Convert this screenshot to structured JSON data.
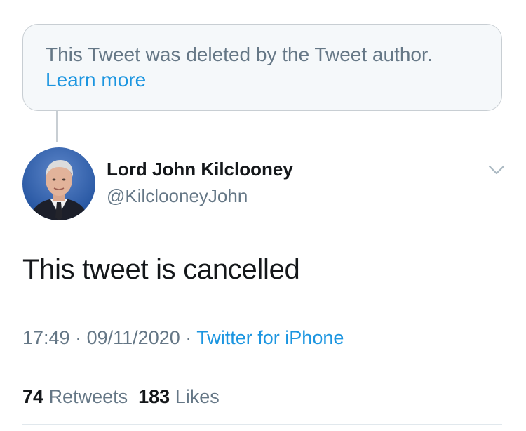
{
  "deleted_notice": {
    "text": "This Tweet was deleted by the Tweet author.",
    "link": "Learn more"
  },
  "author": {
    "display_name": "Lord John Kilclooney",
    "handle": "@KilclooneyJohn"
  },
  "tweet": {
    "text": "This tweet is cancelled",
    "time": "17:49",
    "date": "09/11/2020",
    "separator": "·",
    "source": "Twitter for iPhone"
  },
  "stats": {
    "retweets_count": "74",
    "retweets_label": "Retweets",
    "likes_count": "183",
    "likes_label": "Likes"
  },
  "icons": {
    "menu": "chevron-down-icon",
    "avatar": "avatar"
  },
  "colors": {
    "link": "#1b95e0",
    "secondary_text": "#657786",
    "primary_text": "#14171a",
    "deleted_box_bg": "#f5f8fa"
  }
}
